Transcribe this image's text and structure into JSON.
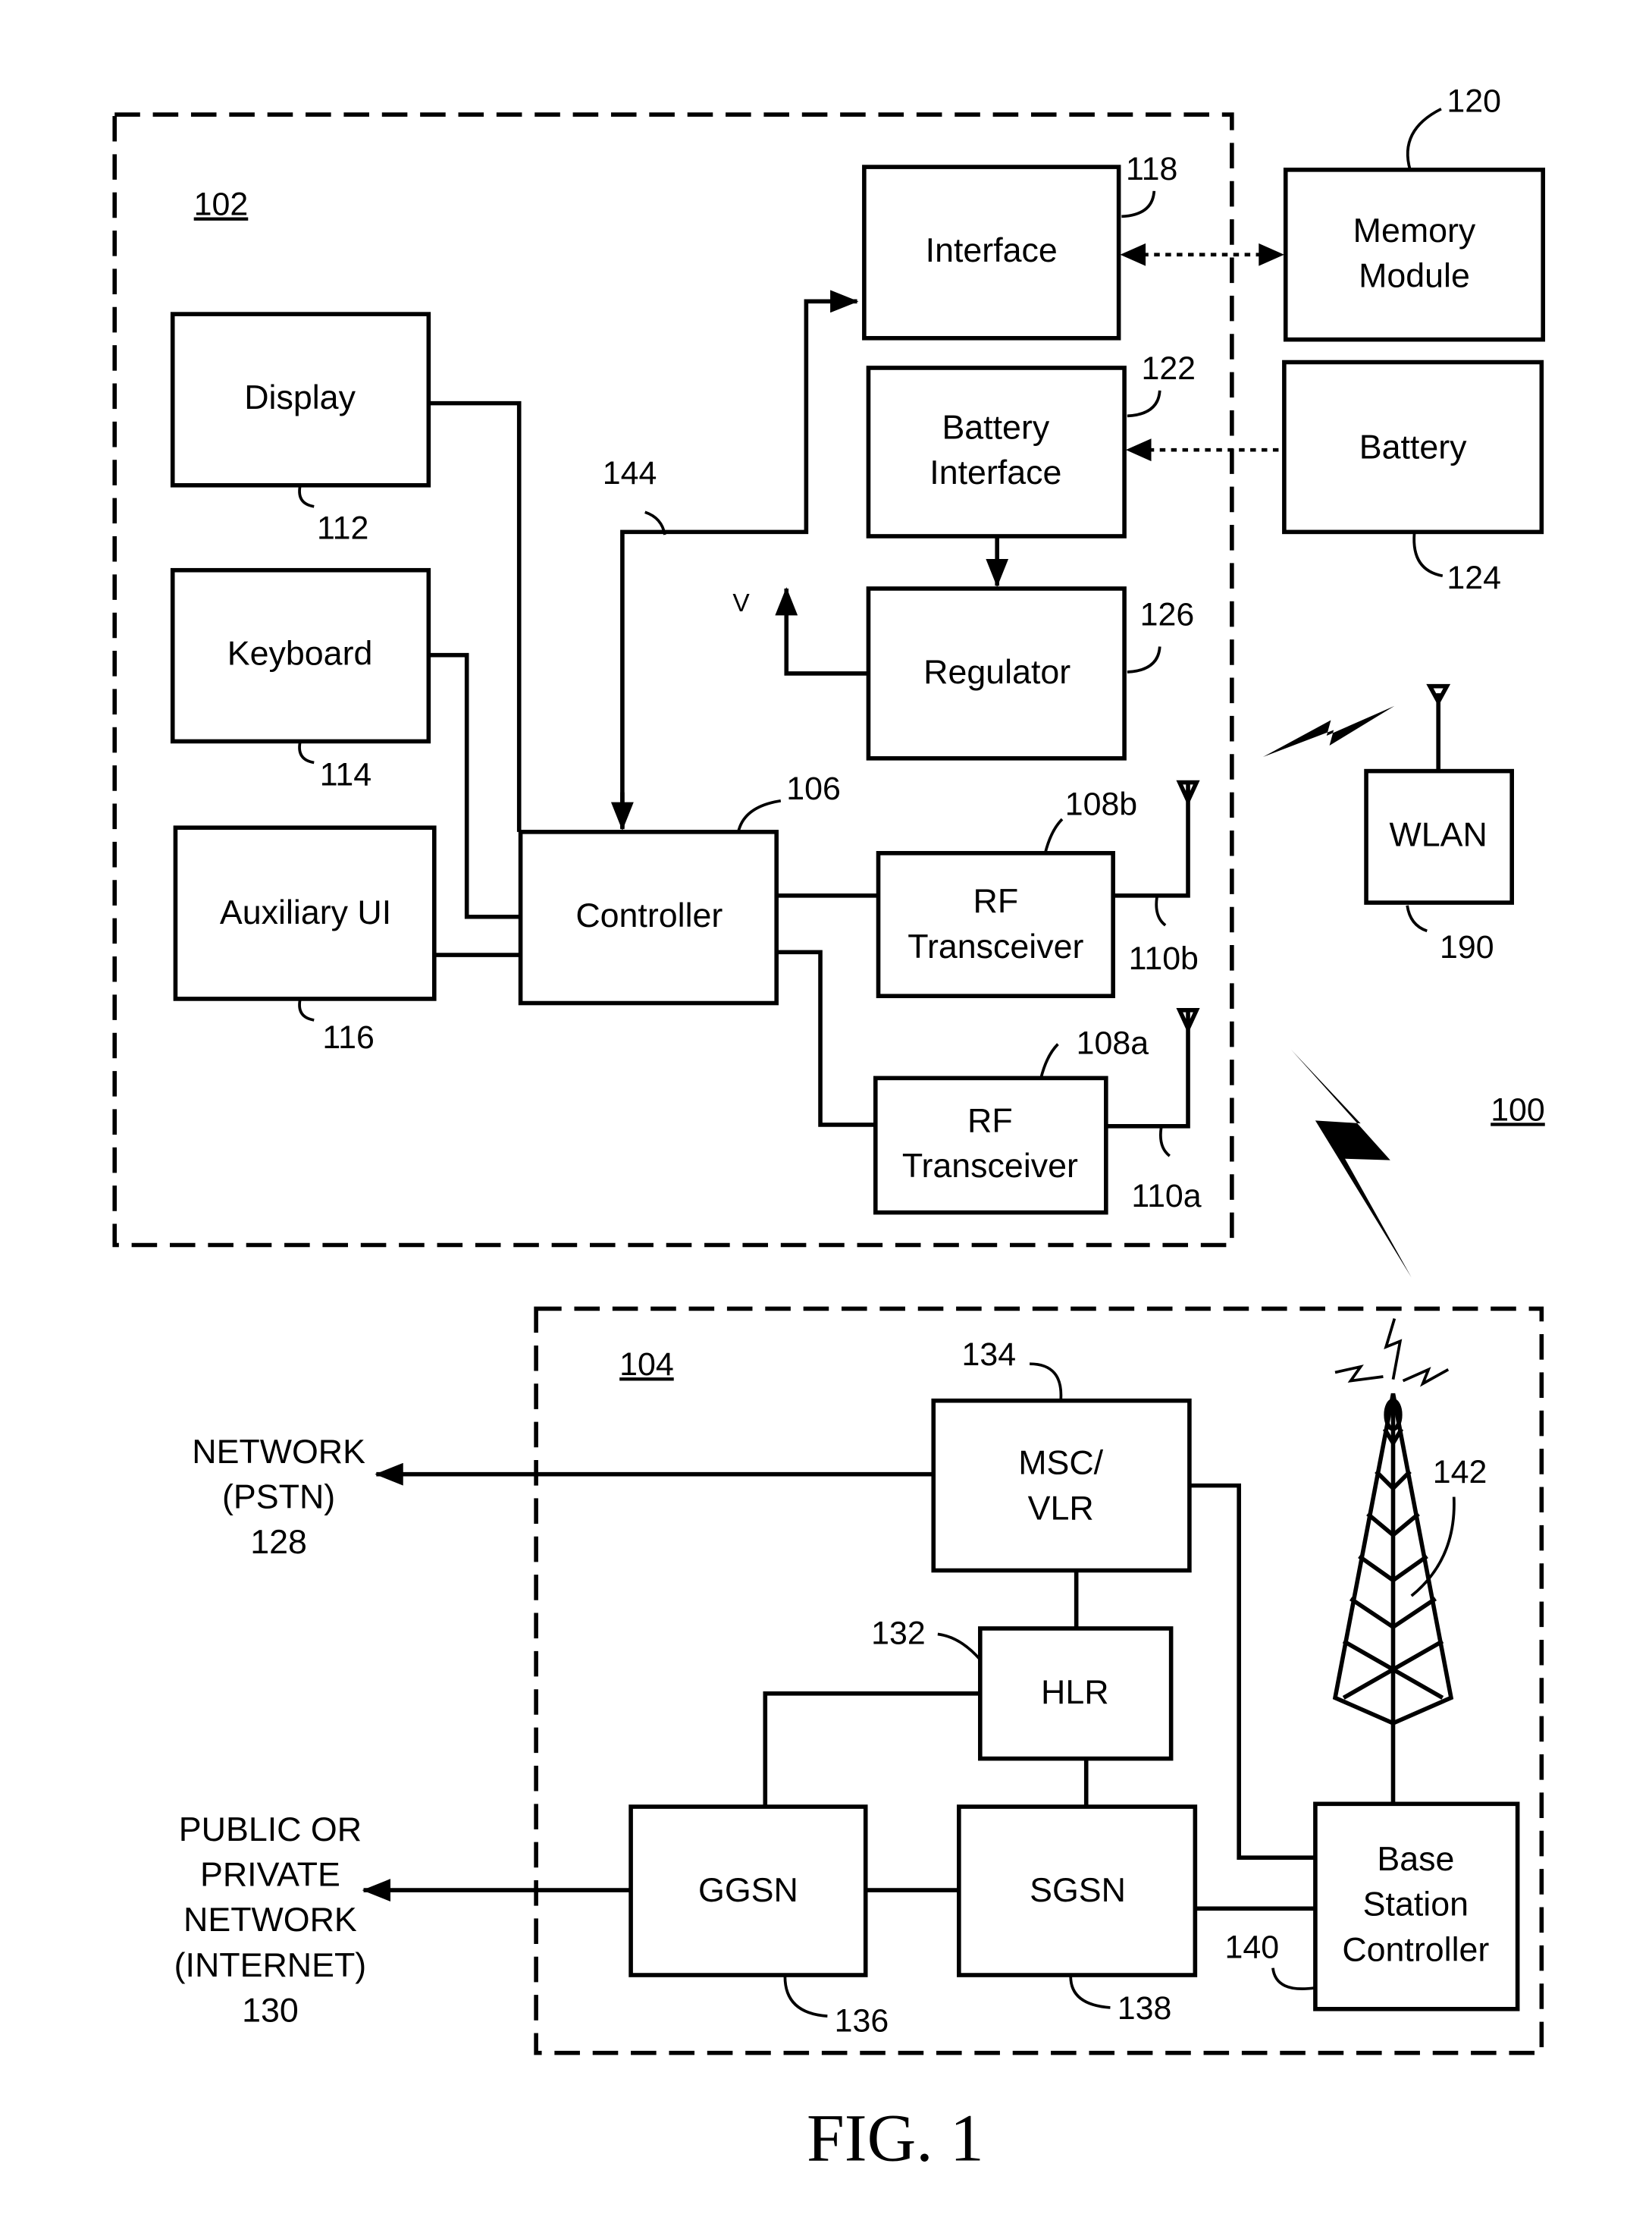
{
  "figure": {
    "caption": "FIG. 1",
    "system_ref": "100"
  },
  "device": {
    "ref": "102",
    "blocks": {
      "display": {
        "label": "Display",
        "ref": "112"
      },
      "keyboard": {
        "label": "Keyboard",
        "ref": "114"
      },
      "auxiliary_ui": {
        "label": "Auxiliary UI",
        "ref": "116"
      },
      "controller": {
        "label": "Controller",
        "ref": "106"
      },
      "interface": {
        "label": "Interface",
        "ref": "118"
      },
      "battery_interface": {
        "label_line1": "Battery",
        "label_line2": "Interface",
        "ref": "122"
      },
      "regulator": {
        "label": "Regulator",
        "ref": "126"
      },
      "rf_transceiver_b": {
        "label_line1": "RF",
        "label_line2": "Transceiver",
        "ref": "108b",
        "antenna_ref": "110b"
      },
      "rf_transceiver_a": {
        "label_line1": "RF",
        "label_line2": "Transceiver",
        "ref": "108a",
        "antenna_ref": "110a"
      }
    },
    "bus_ref": "144",
    "voltage_label": "V"
  },
  "external": {
    "memory_module": {
      "label_line1": "Memory",
      "label_line2": "Module",
      "ref": "120"
    },
    "battery": {
      "label": "Battery",
      "ref": "124"
    },
    "wlan": {
      "label": "WLAN",
      "ref": "190"
    }
  },
  "network": {
    "ref": "104",
    "blocks": {
      "msc_vlr": {
        "label_line1": "MSC/",
        "label_line2": "VLR",
        "ref": "134"
      },
      "hlr": {
        "label": "HLR",
        "ref": "132"
      },
      "ggsn": {
        "label": "GGSN",
        "ref": "136"
      },
      "sgsn": {
        "label": "SGSN",
        "ref": "138"
      },
      "bsc": {
        "label_line1": "Base",
        "label_line2": "Station",
        "label_line3": "Controller",
        "ref": "140"
      },
      "tower": {
        "ref": "142"
      }
    },
    "pstn": {
      "line1": "NETWORK",
      "line2": "(PSTN)",
      "ref": "128"
    },
    "internet": {
      "line1": "PUBLIC OR",
      "line2": "PRIVATE",
      "line3": "NETWORK",
      "line4": "(INTERNET)",
      "ref": "130"
    }
  }
}
